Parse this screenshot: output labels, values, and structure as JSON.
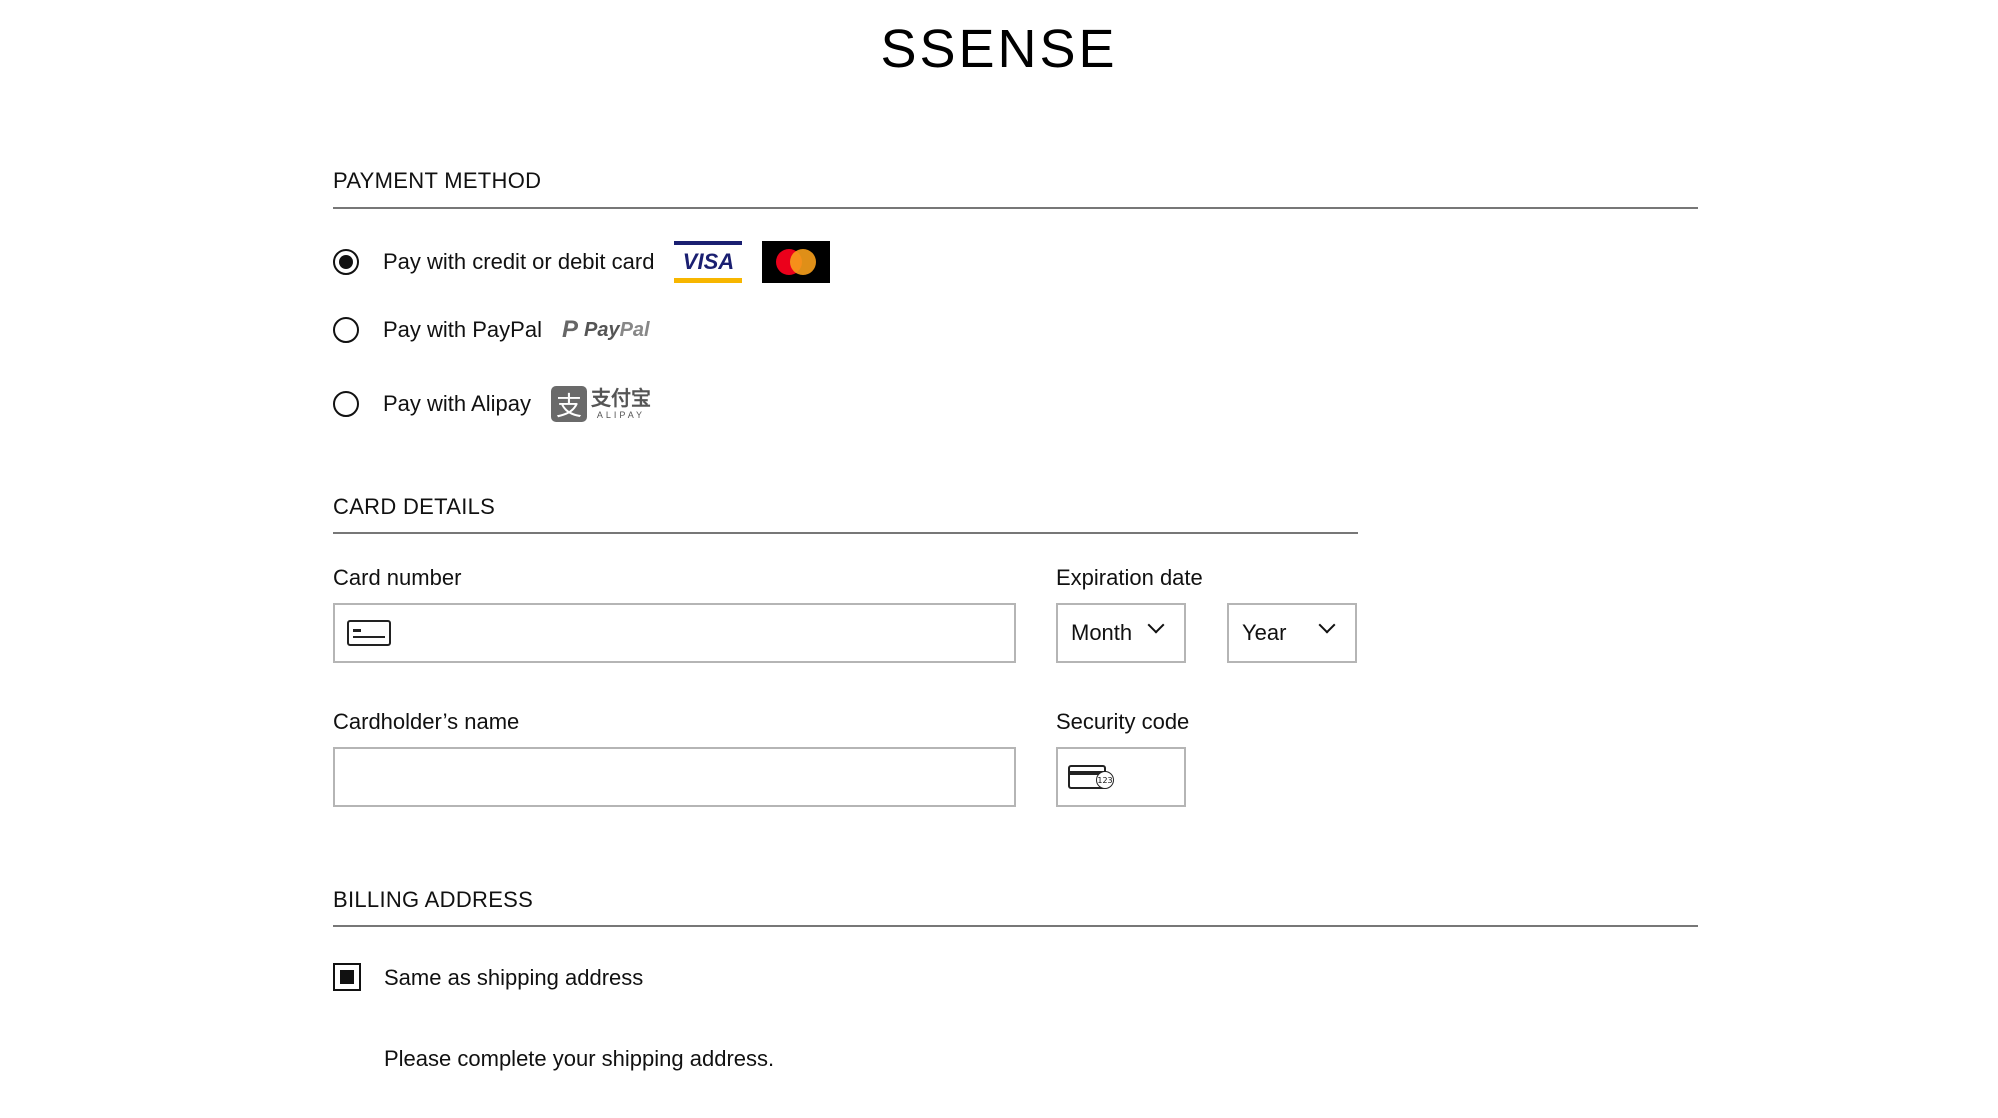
{
  "brand": {
    "logo_text": "SSENSE"
  },
  "payment_method": {
    "heading": "PAYMENT METHOD",
    "options": [
      {
        "label": "Pay with credit or debit card",
        "selected": true
      },
      {
        "label": "Pay with PayPal",
        "selected": false
      },
      {
        "label": "Pay with Alipay",
        "selected": false
      }
    ],
    "logos": {
      "visa_text": "VISA",
      "paypal_text_1": "Pay",
      "paypal_text_2": "Pal",
      "alipay_cn": "支付宝",
      "alipay_en": "ALIPAY"
    }
  },
  "card_details": {
    "heading": "CARD DETAILS",
    "card_number": {
      "label": "Card number",
      "value": "",
      "placeholder": ""
    },
    "expiration": {
      "label": "Expiration date",
      "month": {
        "value": "Month"
      },
      "year": {
        "value": "Year"
      }
    },
    "cardholder_name": {
      "label": "Cardholder’s name",
      "value": "",
      "placeholder": ""
    },
    "security_code": {
      "label": "Security code",
      "value": "",
      "placeholder": "",
      "icon_text": "123"
    }
  },
  "billing_address": {
    "heading": "BILLING ADDRESS",
    "same_as_shipping": {
      "label": "Same as shipping address",
      "checked": true
    },
    "message": "Please complete your shipping address."
  },
  "colors": {
    "text": "#111111",
    "rule": "#777777",
    "input_border": "#b5b5b5",
    "visa_blue": "#1a1f71",
    "visa_gold": "#f7b600",
    "mastercard_red": "#eb001b",
    "mastercard_orange": "#f79e1b"
  },
  "icons": {
    "card_number": "credit-card-icon",
    "security_code": "card-cvc-icon",
    "select": "chevron-down-icon"
  }
}
